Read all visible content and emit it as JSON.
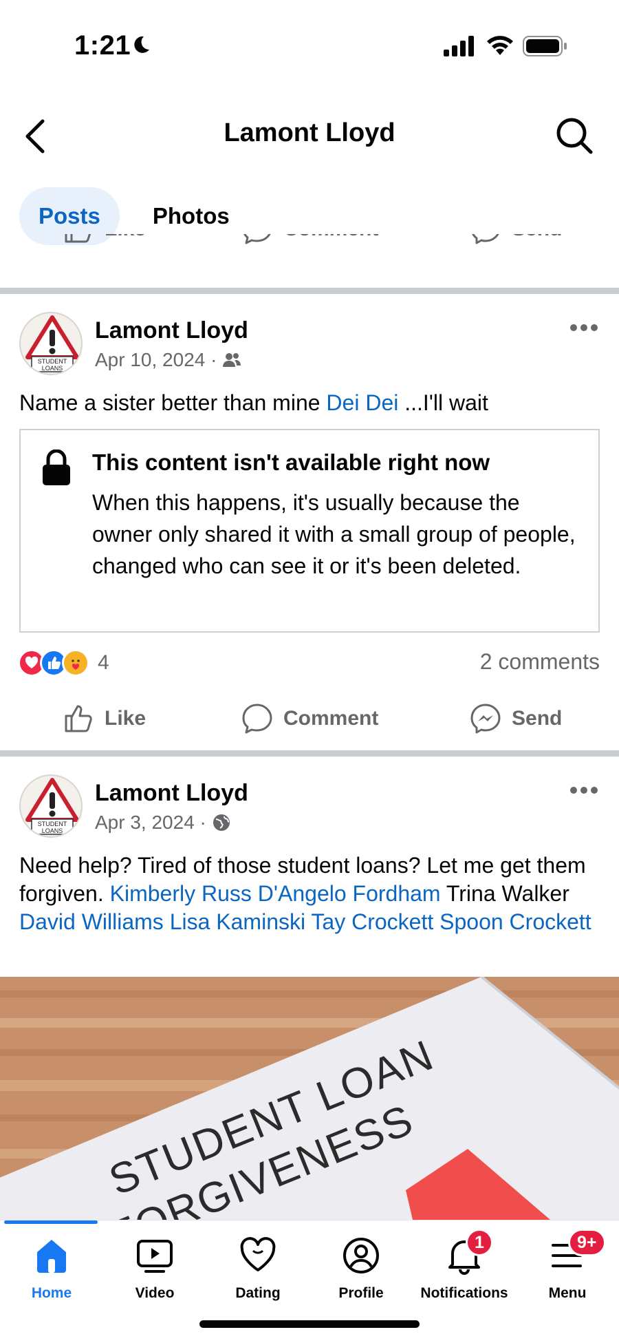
{
  "status_bar": {
    "time": "1:21"
  },
  "header": {
    "title": "Lamont Lloyd"
  },
  "tabs": [
    {
      "label": "Posts",
      "active": true
    },
    {
      "label": "Photos",
      "active": false
    }
  ],
  "actions": {
    "like": "Like",
    "comment": "Comment",
    "send": "Send"
  },
  "post1": {
    "author": "Lamont Lloyd",
    "date": "Apr 10, 2024 ·",
    "audience_icon": "friends-icon",
    "avatar_text": [
      "STUDENT",
      "LOANS"
    ],
    "text_before": "Name a sister better than mine ",
    "tagged": "Dei Dei",
    "text_after": " ...I'll wait",
    "unavailable_title": "This content isn't available right now",
    "unavailable_body": "When this happens, it's usually because the owner only shared it with a small group of people, changed who can see it or it's been deleted.",
    "reaction_count": "4",
    "comments": "2 comments"
  },
  "post2": {
    "author": "Lamont Lloyd",
    "date": "Apr 3, 2024 ·",
    "audience_icon": "globe-icon",
    "avatar_text": [
      "STUDENT",
      "LOANS"
    ],
    "text_lead": "Need help? Tired of those student loans? Let me get them forgiven. ",
    "tag1": "Kimberly Russ",
    "tag2": "D'Angelo Fordham",
    "plain_name": "Trina Walker",
    "tag3": "David Williams",
    "tag4": "Lisa Kaminski",
    "tag5": "Tay Crockett",
    "tag6": "Spoon Crockett",
    "image_text_line1": "STUDENT LOAN",
    "image_text_line2": "FORGIVENESS"
  },
  "bottom_nav": [
    {
      "label": "Home",
      "icon": "home-icon",
      "active": true
    },
    {
      "label": "Video",
      "icon": "video-icon",
      "active": false
    },
    {
      "label": "Dating",
      "icon": "heart-icon",
      "active": false
    },
    {
      "label": "Profile",
      "icon": "profile-icon",
      "active": false
    },
    {
      "label": "Notifications",
      "icon": "bell-icon",
      "active": false,
      "badge": "1"
    },
    {
      "label": "Menu",
      "icon": "menu-icon",
      "active": false,
      "badge": "9+"
    }
  ],
  "colors": {
    "accent": "#1877f2",
    "link": "#0a66c2",
    "badge": "#e41e3f",
    "divider": "#c9ccd1"
  }
}
